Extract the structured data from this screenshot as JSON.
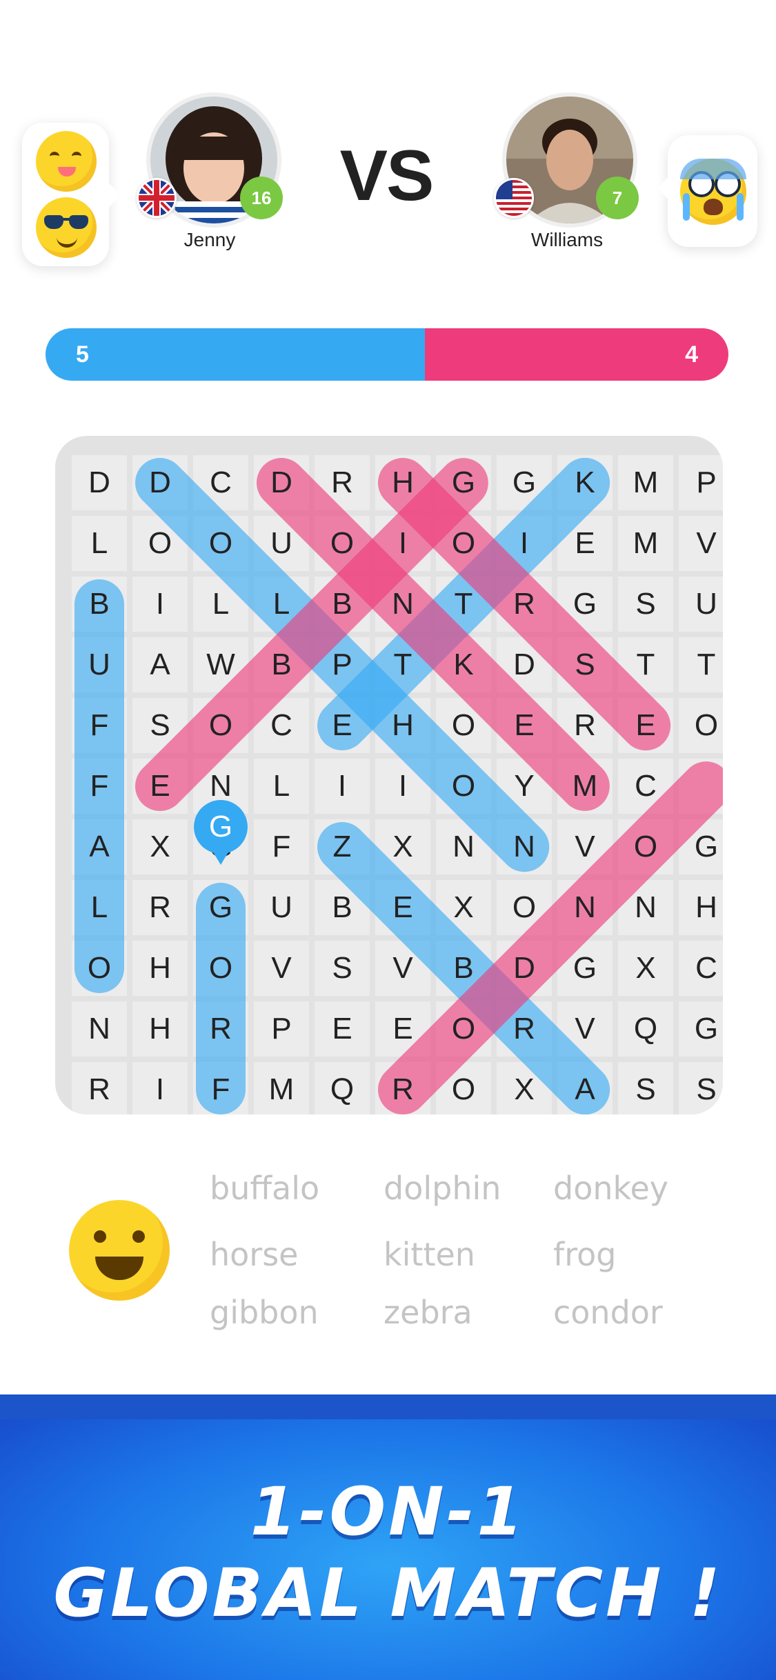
{
  "players": {
    "left": {
      "name": "Jenny",
      "level": "16",
      "flag": "uk-flag-icon"
    },
    "right": {
      "name": "Williams",
      "level": "7",
      "flag": "us-flag-icon"
    },
    "vs_label": "VS"
  },
  "score": {
    "left": "5",
    "right": "4",
    "left_share": 0.5556
  },
  "grid": {
    "rows": [
      "DDCDRHGGKMP",
      "LOOUOIOIEMV",
      "BILLBNTRGSU",
      "UAWBPTKDSTT",
      "FSOCEHOEREO",
      "FENLIIOYMC",
      "AXGFZXNNVOG",
      "LRGUBEXONNH",
      "OHOVSVBDGXC",
      "NHRPEEORVQG",
      "RIFMQROXASS"
    ],
    "current_letter": "G"
  },
  "words": [
    [
      "buffalo",
      "dolphin",
      "donkey"
    ],
    [
      "horse",
      "kitten",
      "frog"
    ],
    [
      "gibbon",
      "zebra",
      "condor"
    ]
  ],
  "banner": {
    "line1": "1-ON-1",
    "line2": "GLOBAL MATCH !"
  },
  "colors": {
    "blue": "#36a9f3",
    "pink": "#ee3b7b",
    "banner": "#1c76e8"
  }
}
